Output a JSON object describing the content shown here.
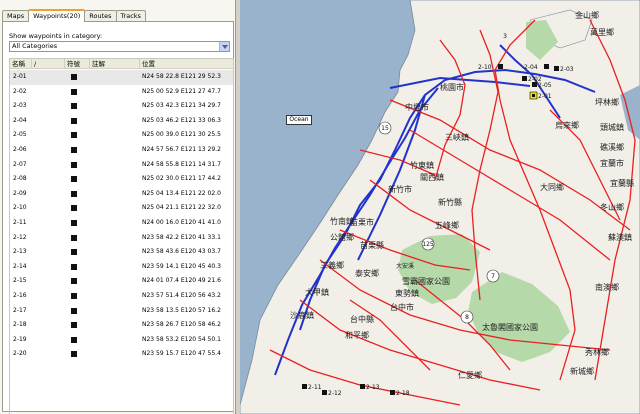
{
  "tabs": [
    {
      "label": "Maps"
    },
    {
      "label": "Waypoints(20)"
    },
    {
      "label": "Routes"
    },
    {
      "label": "Tracks"
    }
  ],
  "category": {
    "label": "Show waypoints in category:",
    "selected": "All Categories"
  },
  "table": {
    "headers": [
      "名稱",
      "/",
      "符號",
      "註解",
      "位置"
    ],
    "rows": [
      {
        "name": "2-01",
        "position": "N24 58 22.8 E121 29 52.3"
      },
      {
        "name": "2-02",
        "position": "N25 00 52.9 E121 27 47.7"
      },
      {
        "name": "2-03",
        "position": "N25 03 42.3 E121 34 29.7"
      },
      {
        "name": "2-04",
        "position": "N25 03 46.2 E121 33 06.3"
      },
      {
        "name": "2-05",
        "position": "N25 00 39.0 E121 30 25.5"
      },
      {
        "name": "2-06",
        "position": "N24 57 56.7 E121 13 29.2"
      },
      {
        "name": "2-07",
        "position": "N24 58 55.8 E121 14 31.7"
      },
      {
        "name": "2-08",
        "position": "N25 02 30.0 E121 17 44.2"
      },
      {
        "name": "2-09",
        "position": "N25 04 13.4 E121 22 02.0"
      },
      {
        "name": "2-10",
        "position": "N25 04 21.1 E121 22 32.0"
      },
      {
        "name": "2-11",
        "position": "N24 00 16.0 E120 41 41.0"
      },
      {
        "name": "2-12",
        "position": "N23 58 42.2 E120 41 33.1"
      },
      {
        "name": "2-13",
        "position": "N23 58 43.6 E120 43 03.7"
      },
      {
        "name": "2-14",
        "position": "N23 59 14.1 E120 45 40.3"
      },
      {
        "name": "2-15",
        "position": "N24 01 07.4 E120 49 21.6"
      },
      {
        "name": "2-16",
        "position": "N23 57 51.4 E120 56 43.2"
      },
      {
        "name": "2-17",
        "position": "N23 58 13.5 E120 57 16.2"
      },
      {
        "name": "2-18",
        "position": "N23 58 26.7 E120 58 46.2"
      },
      {
        "name": "2-19",
        "position": "N23 58 53.2 E120 54 50.1"
      },
      {
        "name": "2-20",
        "position": "N23 59 15.7 E120 47 55.4"
      }
    ]
  },
  "map": {
    "ocean_label": "Ocean",
    "place_labels": [
      {
        "text": "金山鄉"
      },
      {
        "text": "萬里鄉"
      },
      {
        "text": "坪林鄉"
      },
      {
        "text": "烏來鄉"
      },
      {
        "text": "新竹縣"
      },
      {
        "text": "五峰鄉"
      },
      {
        "text": "苗栗縣"
      },
      {
        "text": "泰安鄉"
      },
      {
        "text": "台中縣"
      },
      {
        "text": "和平鄉"
      },
      {
        "text": "大安溪"
      },
      {
        "text": "雪霸國家公園"
      },
      {
        "text": "太魯閣國家公園"
      },
      {
        "text": "仁愛鄉"
      },
      {
        "text": "新城鄉"
      },
      {
        "text": "秀林鄉"
      },
      {
        "text": "宜蘭縣"
      },
      {
        "text": "大同鄉"
      },
      {
        "text": "南澳鄉"
      },
      {
        "text": "三峽鎮"
      },
      {
        "text": "新竹市"
      },
      {
        "text": "竹東鎮"
      },
      {
        "text": "竹南鎮"
      },
      {
        "text": "苗栗市"
      },
      {
        "text": "公館鄉"
      },
      {
        "text": "三義鄉"
      },
      {
        "text": "大甲鎮"
      },
      {
        "text": "台中市"
      },
      {
        "text": "東勢鎮"
      },
      {
        "text": "沙鹿鎮"
      },
      {
        "text": "頭城鎮"
      },
      {
        "text": "礁溪鄉"
      },
      {
        "text": "宜蘭市"
      },
      {
        "text": "冬山鄉"
      },
      {
        "text": "蘇澳鎮"
      },
      {
        "text": "關西鎮"
      },
      {
        "text": "桃園市"
      },
      {
        "text": "中壢市"
      }
    ],
    "route_numbers": [
      "15",
      "3",
      "125",
      "7",
      "8"
    ],
    "waypoint_labels": [
      "2-01",
      "2-02",
      "2-03",
      "2-04",
      "2-05",
      "2-10",
      "2-11",
      "2-12",
      "2-13",
      "2-18"
    ]
  },
  "colors": {
    "sea": "#99b3cc",
    "land": "#f2efe9",
    "park": "#b5d9a8",
    "highway": "#2233cc",
    "road": "#e82020"
  }
}
